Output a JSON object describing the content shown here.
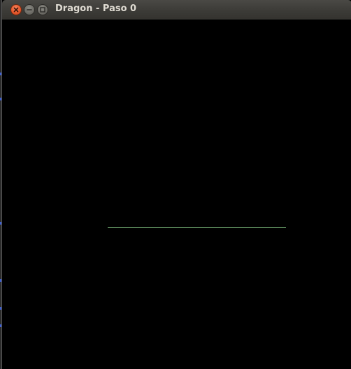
{
  "window": {
    "title": "Dragon - Paso 0"
  },
  "controls": {
    "close_icon": "close-icon",
    "minimize_icon": "minimize-icon",
    "maximize_icon": "maximize-icon"
  },
  "colors": {
    "canvas_background": "#000000",
    "curve_color": "#7fbf7f",
    "titlebar": "#3c3b37",
    "close_button": "#e8582c"
  }
}
